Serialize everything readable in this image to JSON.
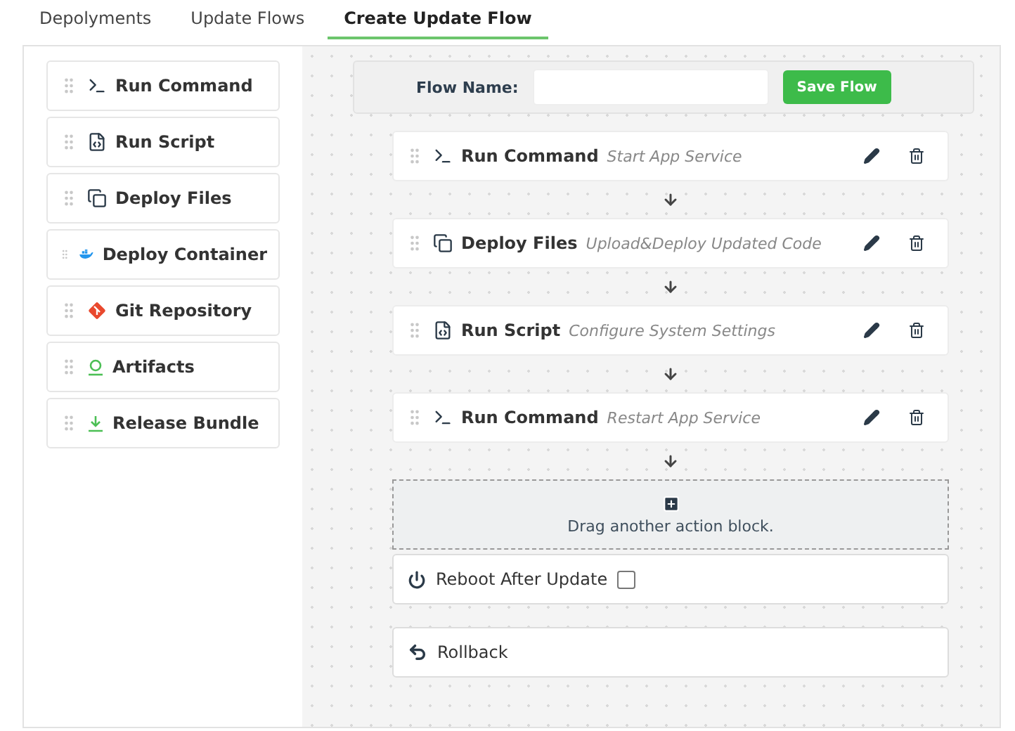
{
  "tabs": [
    {
      "label": "Depolyments",
      "selected": false
    },
    {
      "label": "Update Flows",
      "selected": false
    },
    {
      "label": "Create Update Flow",
      "selected": true
    }
  ],
  "palette": [
    {
      "kind": "command",
      "label": "Run Command"
    },
    {
      "kind": "script",
      "label": "Run Script"
    },
    {
      "kind": "files",
      "label": "Deploy Files"
    },
    {
      "kind": "container",
      "label": "Deploy Container"
    },
    {
      "kind": "git",
      "label": "Git Repository"
    },
    {
      "kind": "artifacts",
      "label": "Artifacts"
    },
    {
      "kind": "bundle",
      "label": "Release Bundle"
    }
  ],
  "flow_name": {
    "label": "Flow Name:",
    "save": "Save Flow"
  },
  "steps": [
    {
      "kind": "command",
      "label": "Run Command",
      "note": "Start App Service"
    },
    {
      "kind": "files",
      "label": "Deploy Files",
      "note": "Upload&Deploy Updated Code"
    },
    {
      "kind": "script",
      "label": "Run Script",
      "note": "Configure System Settings"
    },
    {
      "kind": "command",
      "label": "Run Command",
      "note": "Restart App Service"
    }
  ],
  "drop_zone": {
    "text": "Drag another action block."
  },
  "reboot": {
    "label": "Reboot After Update",
    "checked": false
  },
  "rollback": {
    "label": "Rollback"
  }
}
